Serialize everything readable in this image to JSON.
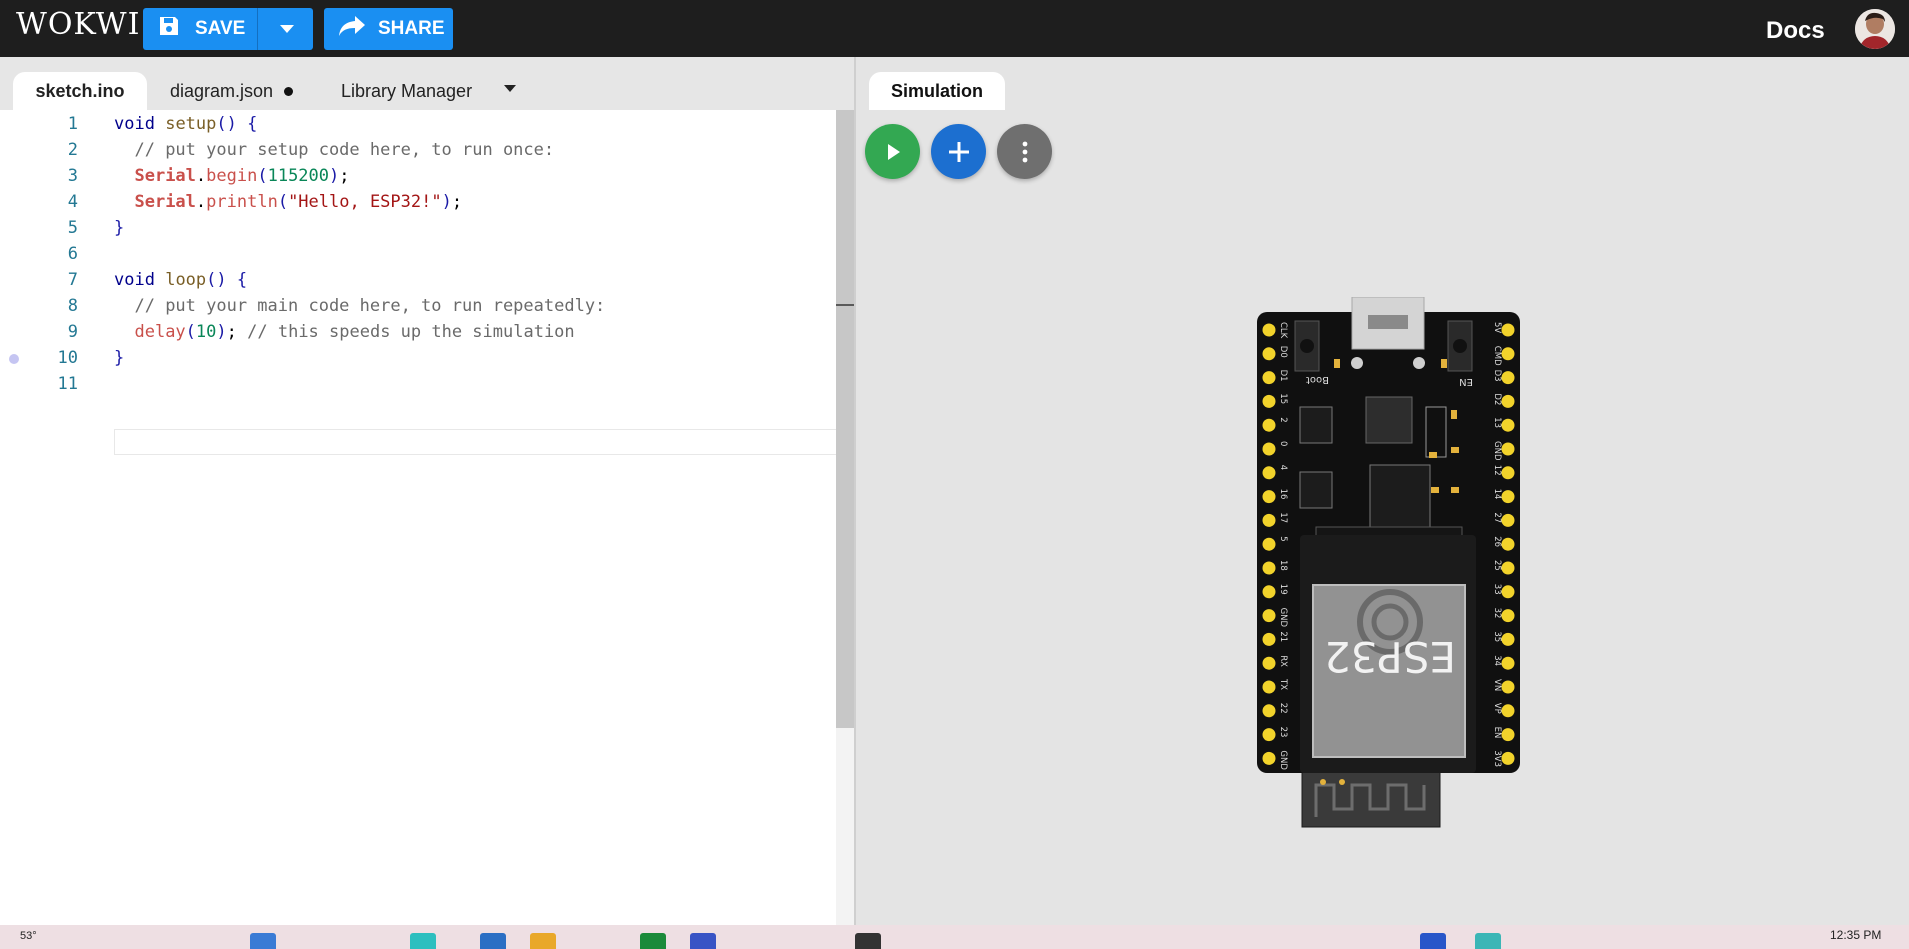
{
  "header": {
    "logo": "WOKWI",
    "save_label": "SAVE",
    "share_label": "SHARE",
    "docs_label": "Docs",
    "accent": "#1a8ff2"
  },
  "editor": {
    "tabs": [
      {
        "label": "sketch.ino",
        "active": true
      },
      {
        "label": "diagram.json",
        "modified": true
      },
      {
        "label": "Library Manager"
      }
    ],
    "lines": [
      {
        "n": "1",
        "text": "void setup() {"
      },
      {
        "n": "2",
        "text": "  // put your setup code here, to run once:"
      },
      {
        "n": "3",
        "text": "  Serial.begin(115200);"
      },
      {
        "n": "4",
        "text": "  Serial.println(\"Hello, ESP32!\");"
      },
      {
        "n": "5",
        "text": "}"
      },
      {
        "n": "6",
        "text": ""
      },
      {
        "n": "7",
        "text": "void loop() {"
      },
      {
        "n": "8",
        "text": "  // put your main code here, to run repeatedly:"
      },
      {
        "n": "9",
        "text": "  delay(10); // this speeds up the simulation"
      },
      {
        "n": "10",
        "text": "}"
      },
      {
        "n": "11",
        "text": ""
      }
    ]
  },
  "simulation": {
    "tab_label": "Simulation",
    "play_color": "#33a852",
    "add_color": "#1c6fd0",
    "menu_color": "#6f6f6f",
    "board": {
      "chip_label": "ESP32",
      "boot_label": "Boot",
      "en_label": "EN",
      "left_pins": [
        "CLK",
        "D0",
        "D1",
        "15",
        "2",
        "0",
        "4",
        "16",
        "17",
        "5",
        "18",
        "19",
        "GND",
        "21",
        "RX",
        "TX",
        "22",
        "23",
        "GND"
      ],
      "right_pins": [
        "5V",
        "CMD",
        "D3",
        "D2",
        "13",
        "GND",
        "12",
        "14",
        "27",
        "26",
        "25",
        "33",
        "32",
        "35",
        "34",
        "VN",
        "VP",
        "EN",
        "3V3"
      ]
    }
  },
  "taskbar": {
    "weather": "53°",
    "time": "12:35 PM"
  }
}
